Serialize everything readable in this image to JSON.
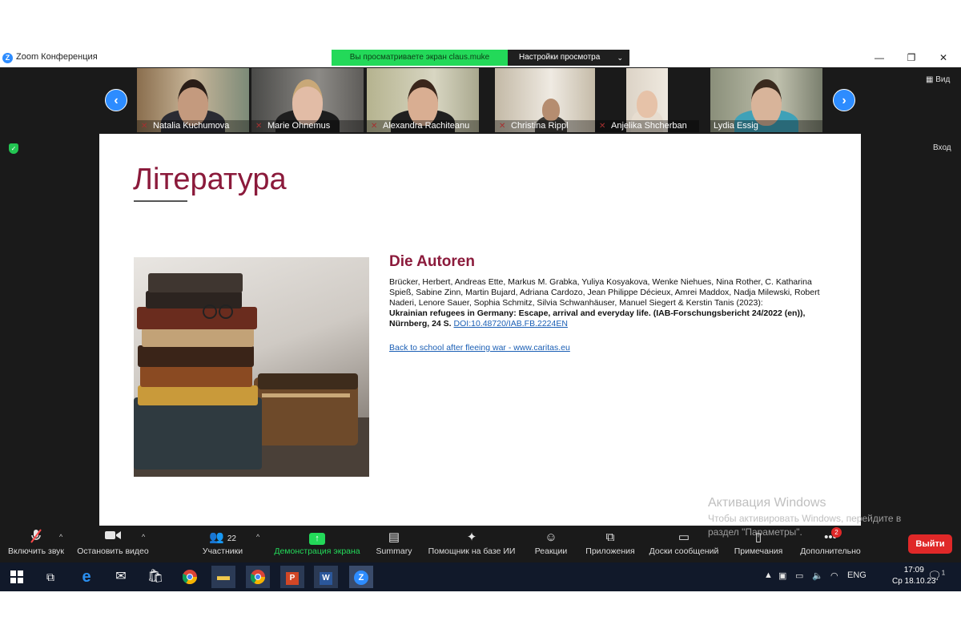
{
  "window": {
    "app_title": "Zoom Конференция",
    "logo_letter": "Z"
  },
  "share_banner": {
    "text": "Вы просматриваете экран claus.muke",
    "settings_label": "Настройки просмотра"
  },
  "window_controls": {
    "minimize": "—",
    "restore": "❐",
    "close": "✕"
  },
  "gallery": {
    "participants": [
      {
        "name": "Natalia Kuchumova"
      },
      {
        "name": "Marie Ohnemus"
      },
      {
        "name": "Alexandra Rachiteanu"
      },
      {
        "name": "Christina Rippl"
      },
      {
        "name": "Anjelika Shcherban"
      },
      {
        "name": "Lydia Essig"
      }
    ],
    "view_label": "Вид",
    "enter_label": "Вход"
  },
  "slide": {
    "title": "Література",
    "section_heading": "Die Autoren",
    "authors_text": "Brücker, Herbert, Andreas Ette, Markus M. Grabka, Yuliya Kosyakova, Wenke Niehues, Nina Rother, C. Katharina Spieß, Sabine Zinn, Martin Bujard, Adriana Cardozo, Jean Philippe Décieux, Amrei Maddox, Nadja Milewski, Robert Naderi, Lenore Sauer, Sophia Schmitz, Silvia Schwanhäuser, Manuel Siegert & Kerstin Tanis (2023):",
    "report_title": "Ukrainian refugees in Germany: Escape, arrival and everyday life. (IAB-Forschungsbericht 24/2022 (en)), Nürnberg, 24 S.",
    "doi_link": "DOI:10.48720/IAB.FB.2224EN",
    "caritas_link": "Back to school after fleeing war - www.caritas.eu"
  },
  "watermark": {
    "line1": "Активация Windows",
    "line2": "Чтобы активировать Windows, перейдите в",
    "line3": "раздел \"Параметры\"."
  },
  "toolbar": {
    "unmute": "Включить звук",
    "stop_video": "Остановить видео",
    "participants": "Участники",
    "participants_count": "22",
    "share_screen": "Демонстрация экрана",
    "summary": "Summary",
    "ai_assistant": "Помощник на базе ИИ",
    "reactions": "Реакции",
    "apps": "Приложения",
    "whiteboards": "Доски сообщений",
    "notes": "Примечания",
    "more": "Дополнительно",
    "more_badge": "2",
    "leave": "Выйти"
  },
  "taskbar": {
    "language": "ENG",
    "time": "17:09",
    "date": "Ср 18.10.23",
    "notification_count": "1"
  },
  "colors": {
    "accent_blue": "#2d8cff",
    "share_green": "#23d959",
    "slide_title": "#8b1a3b",
    "leave_red": "#e02828"
  }
}
